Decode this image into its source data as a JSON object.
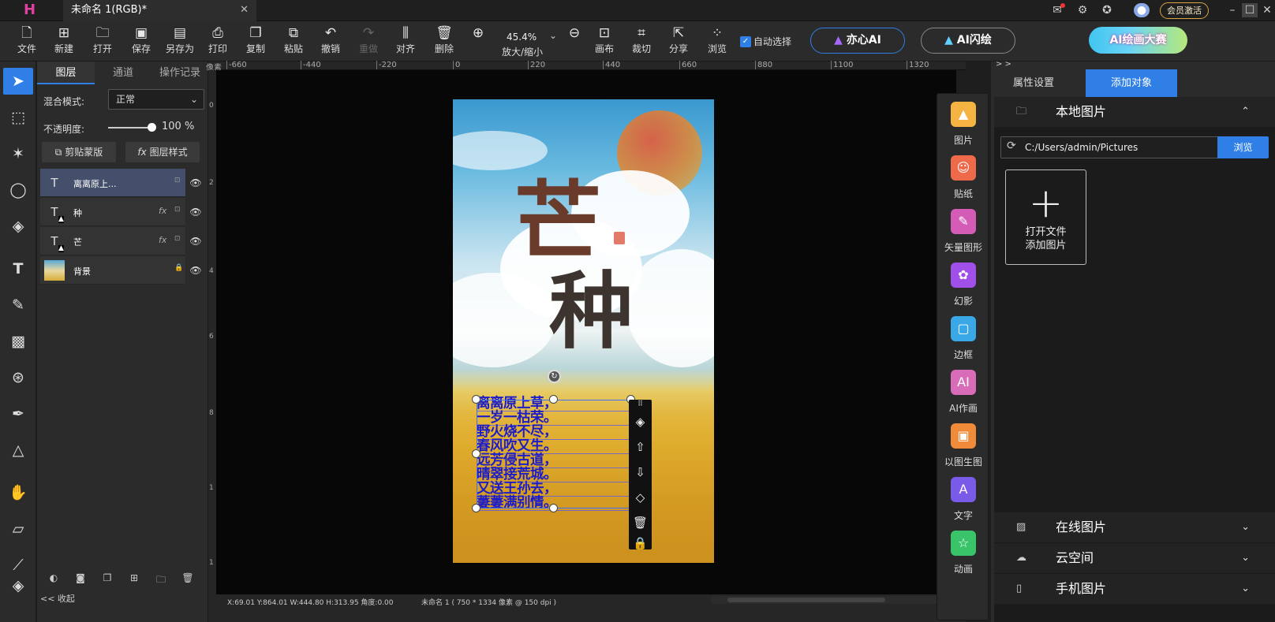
{
  "titlebar": {
    "doc_tab": "未命名 1(RGB)*",
    "close": "✕",
    "vip_button": "会员激活",
    "icons": [
      "mail-icon",
      "settings-icon",
      "compass-icon",
      "user-avatar-icon"
    ]
  },
  "toolbar": {
    "items": [
      {
        "label": "文件",
        "icon": "file-icon"
      },
      {
        "label": "新建",
        "icon": "new-icon"
      },
      {
        "label": "打开",
        "icon": "open-icon"
      },
      {
        "label": "保存",
        "icon": "save-icon"
      },
      {
        "label": "另存为",
        "icon": "save-as-icon"
      },
      {
        "label": "打印",
        "icon": "print-icon"
      },
      {
        "label": "复制",
        "icon": "copy-icon"
      },
      {
        "label": "粘贴",
        "icon": "paste-icon"
      },
      {
        "label": "撤销",
        "icon": "undo-icon"
      },
      {
        "label": "重做",
        "icon": "redo-icon"
      },
      {
        "label": "对齐",
        "icon": "align-icon"
      },
      {
        "label": "删除",
        "icon": "delete-icon"
      }
    ],
    "zoom_value": "45.4%",
    "zoom_label": "放大/缩小",
    "canvas_label": "画布",
    "crop_label": "裁切",
    "share_label": "分享",
    "browse_label": "浏览",
    "auto_select_label": "自动选择",
    "yixin_ai": "亦心AI",
    "ai_flash": "AI闪绘",
    "contest": "AI绘画大赛"
  },
  "layers_panel": {
    "tabs": [
      "图层",
      "通道",
      "操作记录"
    ],
    "blend_label": "混合模式:",
    "blend_value": "正常",
    "opacity_label": "不透明度:",
    "opacity_value": "100 %",
    "opacity": 1.0,
    "clip_mask": "剪贴蒙版",
    "layer_style": "图层样式",
    "layers": [
      {
        "name": "离离原上...",
        "type": "text",
        "selected": true
      },
      {
        "name": "种",
        "type": "text",
        "fx": "fx"
      },
      {
        "name": "芒",
        "type": "text",
        "fx": "fx"
      },
      {
        "name": "背景",
        "type": "image"
      }
    ],
    "collapse": "<< 收起"
  },
  "ruler": {
    "unit": "像素",
    "h_ticks": [
      "-660",
      "-440",
      "-220",
      "0",
      "220",
      "440",
      "660",
      "880",
      "1100",
      "1320"
    ],
    "v_ticks": [
      "0",
      "2",
      "4",
      "6",
      "8",
      "1",
      "1"
    ]
  },
  "artwork": {
    "title1": "芒",
    "title2": "种",
    "poem": [
      "离离原上草，",
      "一岁一枯荣。",
      "野火烧不尽，",
      "春风吹又生。",
      "远芳侵古道，",
      "晴翠接荒城。",
      "又送王孙去，",
      "萋萋满别情。"
    ]
  },
  "statusbar": {
    "coords": "X:69.01 Y:864.01 W:444.80 H:313.95 角度:0.00",
    "doc_info": "未命名 1 ( 750 * 1334 像素 @ 150 dpi )"
  },
  "asset_strip": [
    {
      "label": "图片",
      "color": "#f5b342",
      "icon": "image-icon"
    },
    {
      "label": "贴纸",
      "color": "#ef6a4a",
      "icon": "sticker-icon"
    },
    {
      "label": "矢量图形",
      "color": "#d45cb6",
      "icon": "vector-icon"
    },
    {
      "label": "幻影",
      "color": "#a050e8",
      "icon": "phantom-icon"
    },
    {
      "label": "边框",
      "color": "#3aa8e6",
      "icon": "frame-icon"
    },
    {
      "label": "AI作画",
      "color": "#d86cb8",
      "icon": "ai-paint-icon"
    },
    {
      "label": "以图生图",
      "color": "#f08b3a",
      "icon": "img2img-icon"
    },
    {
      "label": "文字",
      "color": "#7a5ae8",
      "icon": "text-icon"
    },
    {
      "label": "动画",
      "color": "#3ac46a",
      "icon": "animation-icon"
    }
  ],
  "right_panel": {
    "collapse": "> >",
    "tabs": [
      "属性设置",
      "添加对象"
    ],
    "local_images": "本地图片",
    "path": "C:/Users/admin/Pictures",
    "browse": "浏览",
    "open_file_line1": "打开文件",
    "open_file_line2": "添加图片",
    "online_images": "在线图片",
    "cloud_space": "云空间",
    "phone_images": "手机图片"
  }
}
